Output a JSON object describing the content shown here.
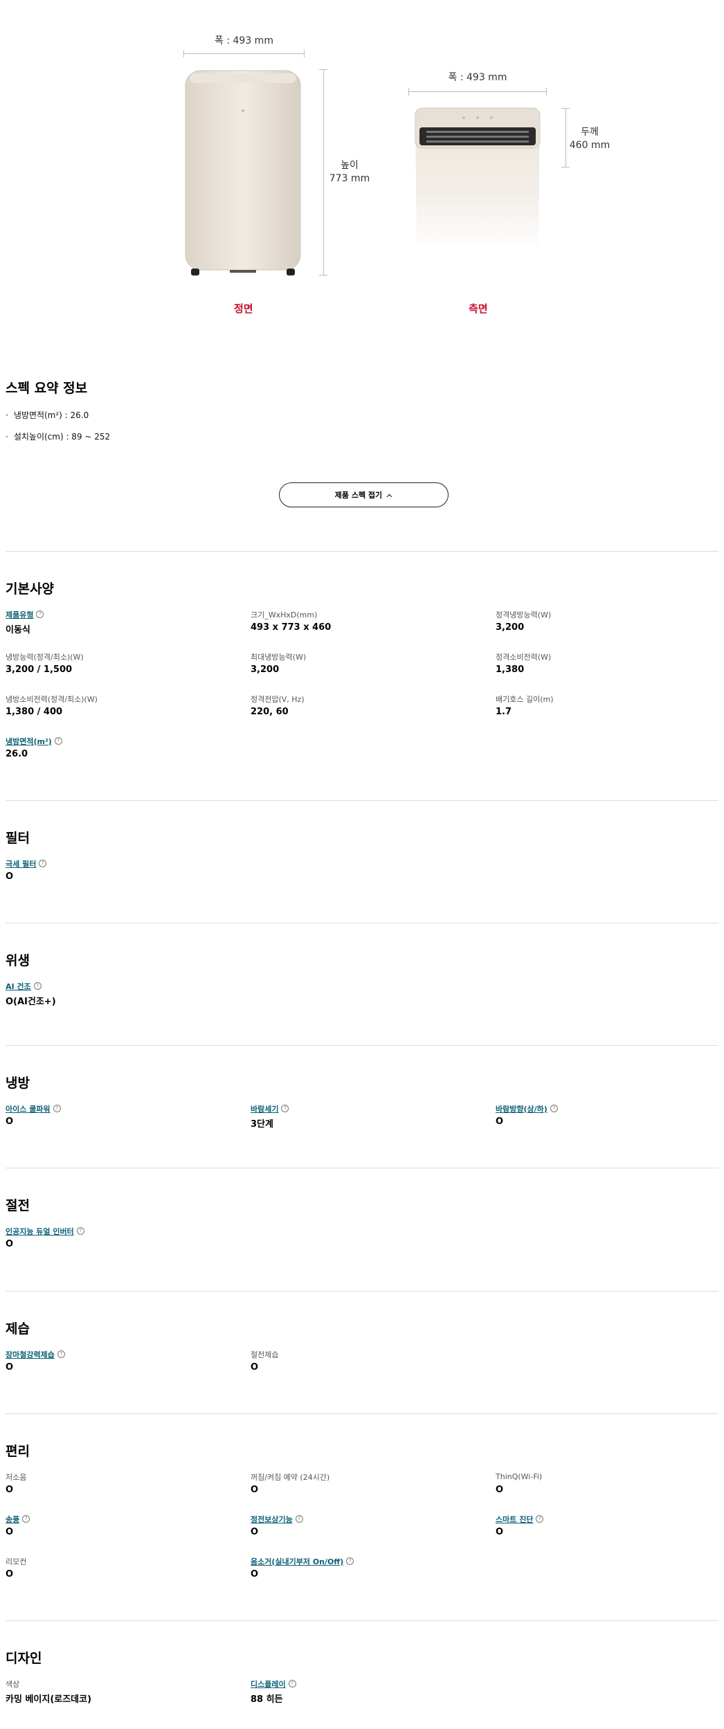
{
  "dimensions": {
    "front_width": "폭 : 493 mm",
    "front_height_label": "높이",
    "front_height_value": "773 mm",
    "side_width": "폭 : 493 mm",
    "side_depth_label": "두께",
    "side_depth_value": "460 mm",
    "front_caption": "정면",
    "side_caption": "측면"
  },
  "summary": {
    "title": "스펙 요약 정보",
    "items": [
      "냉방면적(m²) : 26.0",
      "설치높이(cm) : 89 ~ 252"
    ],
    "fold_button": "제품 스펙 접기",
    "fold_icon": "chevron-up-icon"
  },
  "sections": {
    "basic": {
      "title": "기본사양",
      "specs": [
        {
          "label": "제품유형",
          "value": "이동식",
          "link": true
        },
        {
          "label": "크기_WxHxD(mm)",
          "value": "493 x 773 x 460",
          "link": false
        },
        {
          "label": "정격냉방능력(W)",
          "value": "3,200",
          "link": false
        },
        {
          "label": "냉방능력(정격/최소)(W)",
          "value": "3,200 / 1,500",
          "link": false
        },
        {
          "label": "최대냉방능력(W)",
          "value": "3,200",
          "link": false
        },
        {
          "label": "정격소비전력(W)",
          "value": "1,380",
          "link": false
        },
        {
          "label": "냉방소비전력(정격/최소)(W)",
          "value": "1,380 / 400",
          "link": false
        },
        {
          "label": "정격전압(V, Hz)",
          "value": "220, 60",
          "link": false
        },
        {
          "label": "배기호스 길이(m)",
          "value": "1.7",
          "link": false
        },
        {
          "label": "냉방면적(m²)",
          "value": "26.0",
          "link": true
        }
      ]
    },
    "filter": {
      "title": "필터",
      "specs": [
        {
          "label": "극세 필터",
          "value": "O",
          "link": true
        }
      ]
    },
    "hygiene": {
      "title": "위생",
      "specs": [
        {
          "label": "AI 건조",
          "value": "O(AI건조+)",
          "link": true
        }
      ]
    },
    "cooling": {
      "title": "냉방",
      "specs": [
        {
          "label": "아이스 쿨파워",
          "value": "O",
          "link": true
        },
        {
          "label": "바람세기",
          "value": "3단계",
          "link": true
        },
        {
          "label": "바람방향(상/하)",
          "value": "O",
          "link": true
        }
      ]
    },
    "power": {
      "title": "절전",
      "specs": [
        {
          "label": "인공지능 듀얼 인버터",
          "value": "O",
          "link": true
        }
      ]
    },
    "dehumid": {
      "title": "제습",
      "specs": [
        {
          "label": "장마철강력제습",
          "value": "O",
          "link": true
        },
        {
          "label": "절전제습",
          "value": "O",
          "link": false
        }
      ]
    },
    "convenience": {
      "title": "편리",
      "specs": [
        {
          "label": "저소음",
          "value": "O",
          "link": false
        },
        {
          "label": "꺼짐/켜짐 예약 (24시간)",
          "value": "O",
          "link": false
        },
        {
          "label": "ThinQ(Wi-Fi)",
          "value": "O",
          "link": false
        },
        {
          "label": "송풍",
          "value": "O",
          "link": true
        },
        {
          "label": "정전보상기능",
          "value": "O",
          "link": true
        },
        {
          "label": "스마트 진단",
          "value": "O",
          "link": true
        },
        {
          "label": "리모컨",
          "value": "O",
          "link": false
        },
        {
          "label": "음소거(실내기부저 On/Off)",
          "value": "O",
          "link": true
        }
      ]
    },
    "design": {
      "title": "디자인",
      "specs": [
        {
          "label": "색상",
          "value": "카밍 베이지(로즈데코)",
          "link": false
        },
        {
          "label": "디스플레이",
          "value": "88 히든",
          "link": true
        }
      ]
    }
  },
  "colors": {
    "accent": "#c8102e",
    "link": "#0b5f76"
  }
}
